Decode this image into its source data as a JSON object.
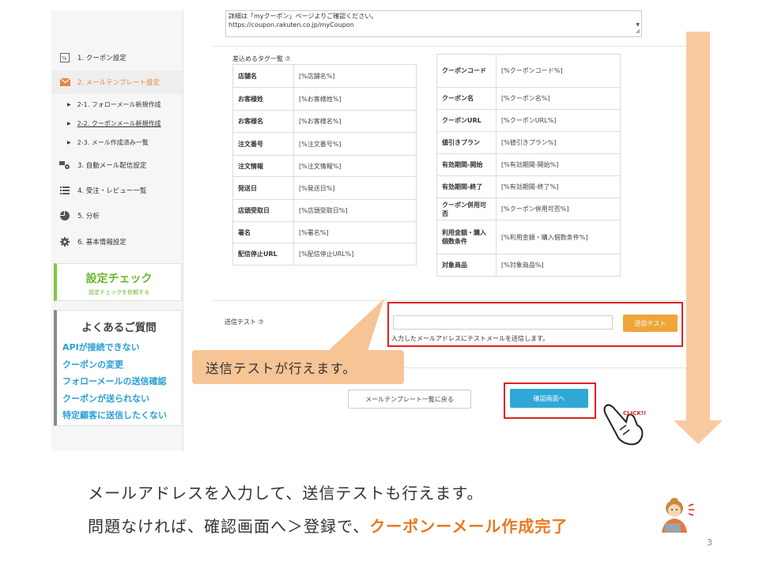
{
  "sidebar": {
    "items": [
      {
        "label": "1. クーポン設定"
      },
      {
        "label": "2. メールテンプレート設定"
      },
      {
        "label": "3. 自動メール配信設定"
      },
      {
        "label": "4. 受注・レビュー一覧"
      },
      {
        "label": "5. 分析"
      },
      {
        "label": "6. 基本情報設定"
      }
    ],
    "sub_items": [
      {
        "label": "2-1. フォローメール新規作成"
      },
      {
        "label": "2-2. クーポンメール新規作成"
      },
      {
        "label": "2-3. メール作成済み一覧"
      }
    ],
    "check": {
      "title": "設定チェック",
      "subtitle": "設定チェックを依頼する"
    },
    "faq": {
      "title": "よくあるご質問",
      "links": [
        "APIが接続できない",
        "クーポンの変更",
        "フォローメールの送信確認",
        "クーポンが送られない",
        "特定顧客に送信したくない"
      ]
    }
  },
  "main": {
    "textarea_lines": [
      "詳細は「myクーポン」ページよりご確認ください。",
      "https://coupon.rakuten.co.jp/myCoupon"
    ],
    "tag_list_label": "差込めるタグ一覧 ⑦",
    "left_tags": [
      {
        "key": "店舗名",
        "val": "[%店舗名%]"
      },
      {
        "key": "お客様姓",
        "val": "[%お客様姓%]"
      },
      {
        "key": "お客様名",
        "val": "[%お客様名%]"
      },
      {
        "key": "注文番号",
        "val": "[%注文番号%]"
      },
      {
        "key": "注文情報",
        "val": "[%注文情報%]"
      },
      {
        "key": "発送日",
        "val": "[%発送日%]"
      },
      {
        "key": "店頭受取日",
        "val": "[%店頭受取日%]"
      },
      {
        "key": "署名",
        "val": "[%署名%]"
      },
      {
        "key": "配信停止URL",
        "val": "[%配信停止URL%]"
      }
    ],
    "right_tags": [
      {
        "key": "クーポンコード",
        "val": "[%クーポンコード%]"
      },
      {
        "key": "クーポン名",
        "val": "[%クーポン名%]"
      },
      {
        "key": "クーポンURL",
        "val": "[%クーポンURL%]"
      },
      {
        "key": "値引きプラン",
        "val": "[%値引きプラン%]"
      },
      {
        "key": "有効期間-開始",
        "val": "[%有効期間-開始%]"
      },
      {
        "key": "有効期間-終了",
        "val": "[%有効期間-終了%]"
      },
      {
        "key": "クーポン併用可否",
        "val": "[%クーポン併用可否%]"
      },
      {
        "key": "利用金額・購入個数条件",
        "val": "[%利用金額・購入個数条件%]"
      },
      {
        "key": "対象商品",
        "val": "[%対象商品%]"
      }
    ],
    "send_test": {
      "label": "送信テスト ⑦",
      "email_value": "",
      "button": "送信テスト",
      "note": "入力したメールアドレスにテストメールを送信します。"
    },
    "back_button": "メールテンプレート一覧に戻る",
    "confirm_button": "確認画面へ"
  },
  "annotations": {
    "callout": "送信テストが行えます。",
    "click": "CLICK!!"
  },
  "captions": {
    "line1": "メールアドレスを入力して、送信テストも行えます。",
    "line2_prefix": "問題なければ、確認画面へ＞登録で、",
    "line2_highlight": "クーポンーメール作成完了"
  },
  "page_number": "3",
  "colors": {
    "accent_orange": "#e9853b",
    "highlight_red": "#e02020",
    "confirm_blue": "#2fa8d8",
    "callout_peach": "#f7c496",
    "arrow_peach": "#f9c9a0",
    "check_green": "#7ecb3a"
  }
}
